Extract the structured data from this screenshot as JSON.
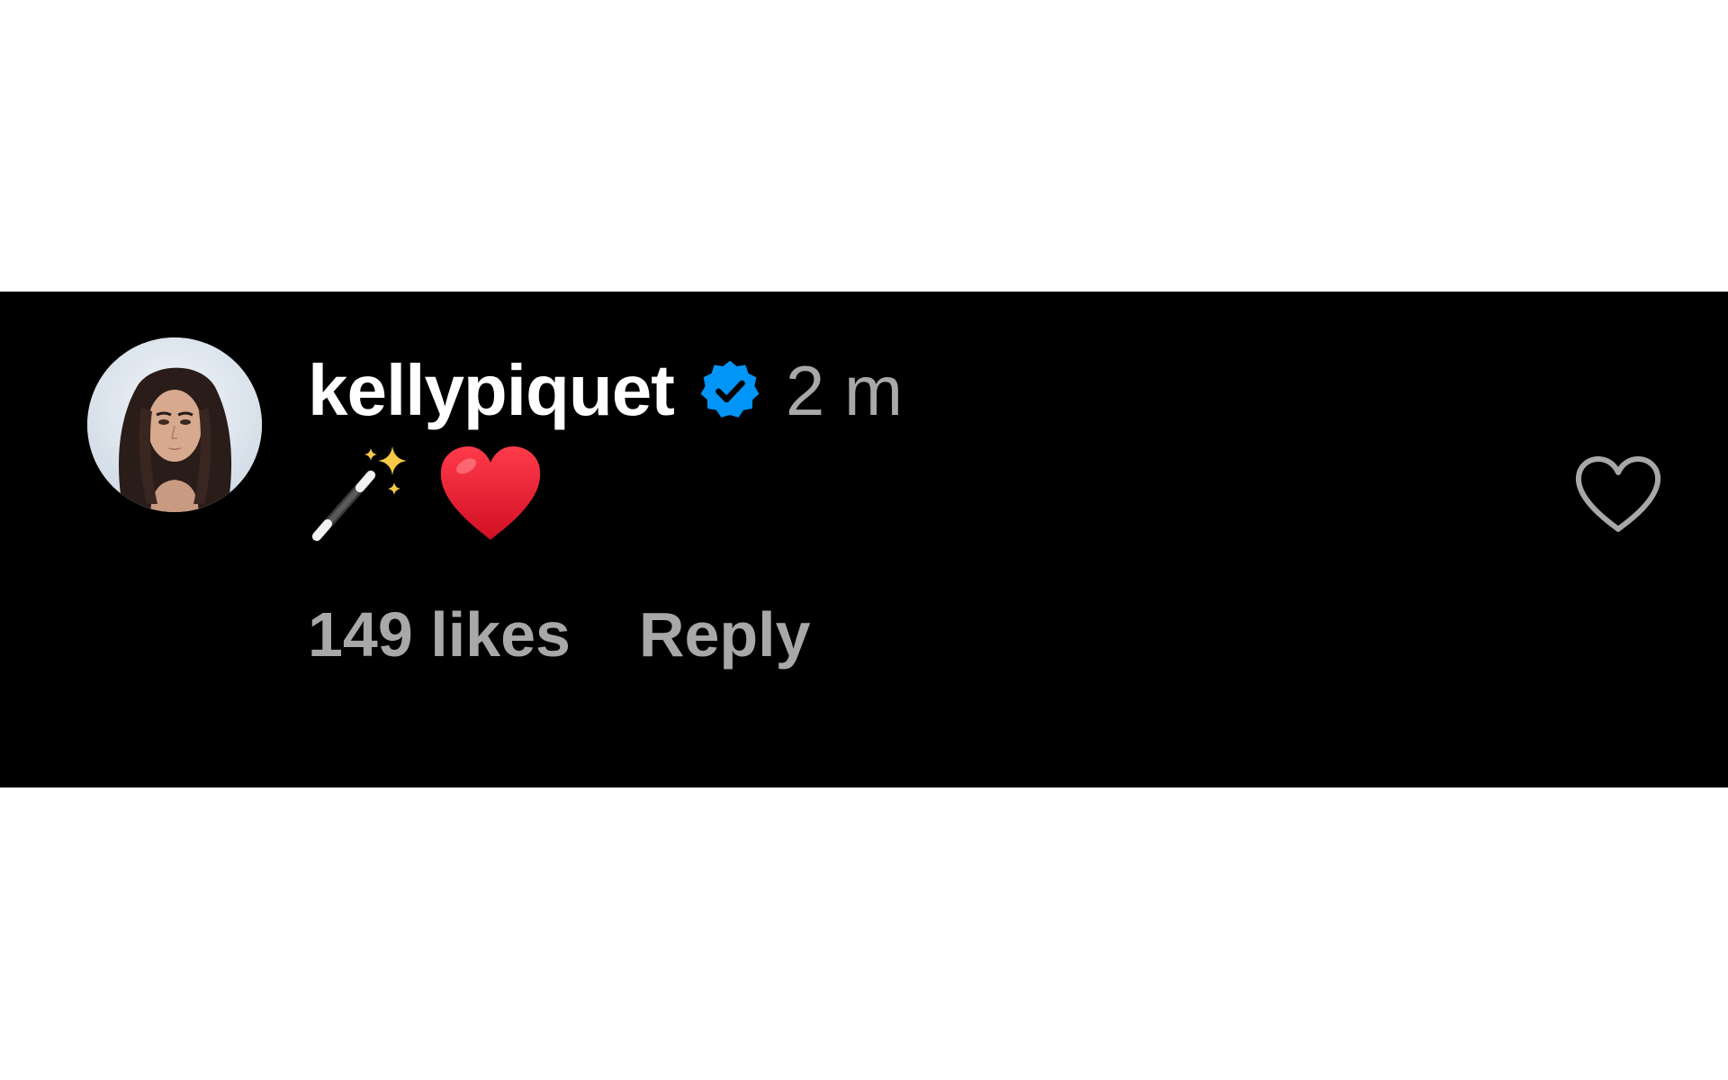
{
  "comment": {
    "username": "kellypiquet",
    "verified": true,
    "timestamp": "2 m",
    "emojis": [
      "magic-wand-emoji",
      "red-heart-emoji"
    ],
    "likes_text": "149 likes",
    "reply_label": "Reply",
    "liked": false
  },
  "colors": {
    "band_background": "#000000",
    "page_background": "#ffffff",
    "username": "#ffffff",
    "secondary_text": "#a8a8a8",
    "verified_badge": "#0095f6",
    "heart_emoji": "#e0192d",
    "like_icon_stroke": "#a8a8a8"
  }
}
